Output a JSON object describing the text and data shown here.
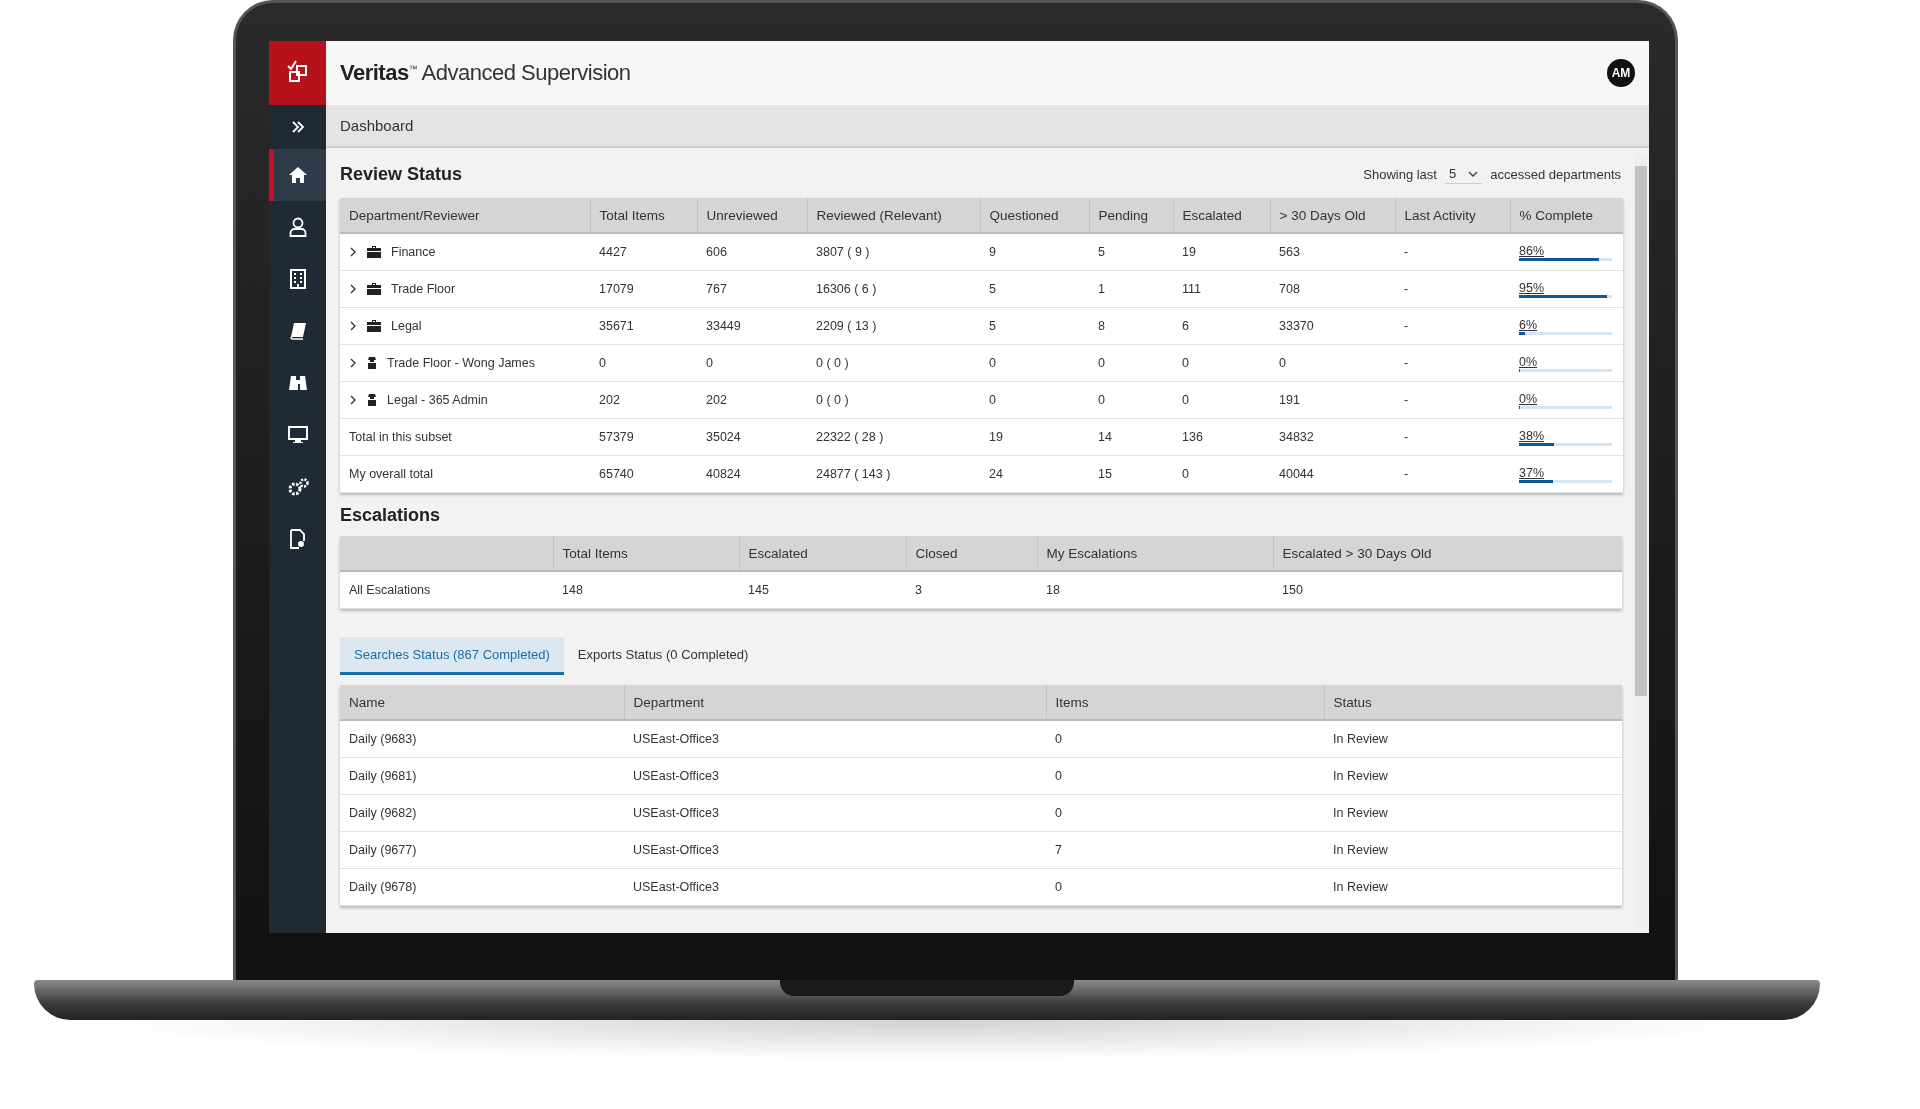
{
  "app": {
    "brand": "Veritas",
    "trademark": "™",
    "product": "Advanced Supervision",
    "avatar": "AM"
  },
  "sidebar": {
    "items": [
      {
        "selected": false
      },
      {
        "selected": true
      },
      {
        "selected": false
      },
      {
        "selected": false
      },
      {
        "selected": false
      },
      {
        "selected": false
      },
      {
        "selected": false
      },
      {
        "selected": false
      },
      {
        "selected": false
      }
    ]
  },
  "breadcrumb": "Dashboard",
  "review_status": {
    "title": "Review Status",
    "showing_prefix": "Showing last",
    "showing_value": "5",
    "showing_suffix": "accessed departments",
    "columns": [
      "Department/Reviewer",
      "Total Items",
      "Unreviewed",
      "Reviewed (Relevant)",
      "Questioned",
      "Pending",
      "Escalated",
      "> 30 Days Old",
      "Last Activity",
      "% Complete"
    ],
    "rows": [
      {
        "kind": "department",
        "cells": [
          "Finance",
          "4427",
          "606",
          "3807 ( 9 )",
          "9",
          "5",
          "19",
          "563",
          "-",
          "86%"
        ],
        "level": 0.86
      },
      {
        "kind": "department",
        "cells": [
          "Trade Floor",
          "17079",
          "767",
          "16306 ( 6 )",
          "5",
          "1",
          "111",
          "708",
          "-",
          "95%"
        ],
        "level": 0.95
      },
      {
        "kind": "department",
        "cells": [
          "Legal",
          "35671",
          "33449",
          "2209 ( 13 )",
          "5",
          "8",
          "6",
          "33370",
          "-",
          "6%"
        ],
        "level": 0.06
      },
      {
        "kind": "reviewer",
        "cells": [
          "Trade Floor - Wong James",
          "0",
          "0",
          "0 ( 0 )",
          "0",
          "0",
          "0",
          "0",
          "-",
          "0%"
        ],
        "level": 0
      },
      {
        "kind": "reviewer",
        "cells": [
          "Legal - 365 Admin",
          "202",
          "202",
          "0 ( 0 )",
          "0",
          "0",
          "0",
          "191",
          "-",
          "0%"
        ],
        "level": 0
      },
      {
        "kind": "total",
        "cells": [
          "Total in this subset",
          "57379",
          "35024",
          "22322 ( 28 )",
          "19",
          "14",
          "136",
          "34832",
          "-",
          "38%"
        ],
        "level": 0.38
      },
      {
        "kind": "total",
        "cells": [
          "My overall total",
          "65740",
          "40824",
          "24877 ( 143 )",
          "24",
          "15",
          "0",
          "40044",
          "-",
          "37%"
        ],
        "level": 0.37
      }
    ]
  },
  "escalations": {
    "title": "Escalations",
    "columns": [
      "",
      "Total Items",
      "Escalated",
      "Closed",
      "My Escalations",
      "Escalated > 30 Days Old"
    ],
    "rows": [
      [
        "All Escalations",
        "148",
        "145",
        "3",
        "18",
        "150"
      ]
    ]
  },
  "tabs": [
    {
      "label": "Searches Status (867 Completed)",
      "selected": true
    },
    {
      "label": "Exports Status (0 Completed)",
      "selected": false
    }
  ],
  "searches": {
    "columns": [
      "Name",
      "Department",
      "Items",
      "Status"
    ],
    "rows": [
      [
        "Daily (9683)",
        "USEast-Office3",
        "0",
        "In Review"
      ],
      [
        "Daily (9681)",
        "USEast-Office3",
        "0",
        "In Review"
      ],
      [
        "Daily (9682)",
        "USEast-Office3",
        "0",
        "In Review"
      ],
      [
        "Daily (9677)",
        "USEast-Office3",
        "7",
        "In Review"
      ],
      [
        "Daily (9678)",
        "USEast-Office3",
        "0",
        "In Review"
      ]
    ]
  }
}
